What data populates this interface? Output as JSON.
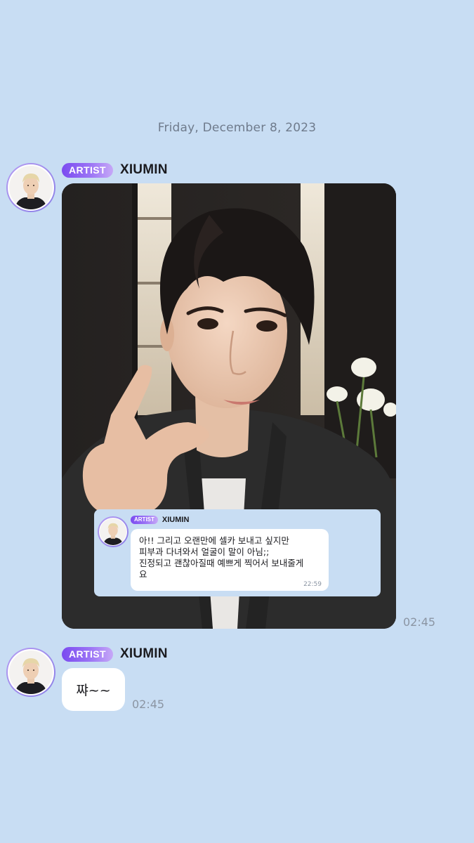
{
  "date_separator": "Friday, December 8, 2023",
  "messages": [
    {
      "badge": "ARTIST",
      "sender": "XIUMIN",
      "time": "02:45",
      "quote": {
        "badge": "ARTIST",
        "sender": "XIUMIN",
        "text": "아!! 그리고 오랜만에 셀카 보내고 싶지만\n피부과 다녀와서 얼굴이 말이 아님;;\n진정되고 괜찮아질때 예쁘게 찍어서 보내줄게\n요",
        "time": "22:59"
      }
    },
    {
      "badge": "ARTIST",
      "sender": "XIUMIN",
      "text": "쨔~~",
      "time": "02:45"
    }
  ],
  "colors": {
    "background": "#c8ddf3",
    "badge_start": "#7b4bf0",
    "badge_end": "#c6a8f7",
    "bubble": "#ffffff",
    "timestamp": "#8b95a3"
  }
}
